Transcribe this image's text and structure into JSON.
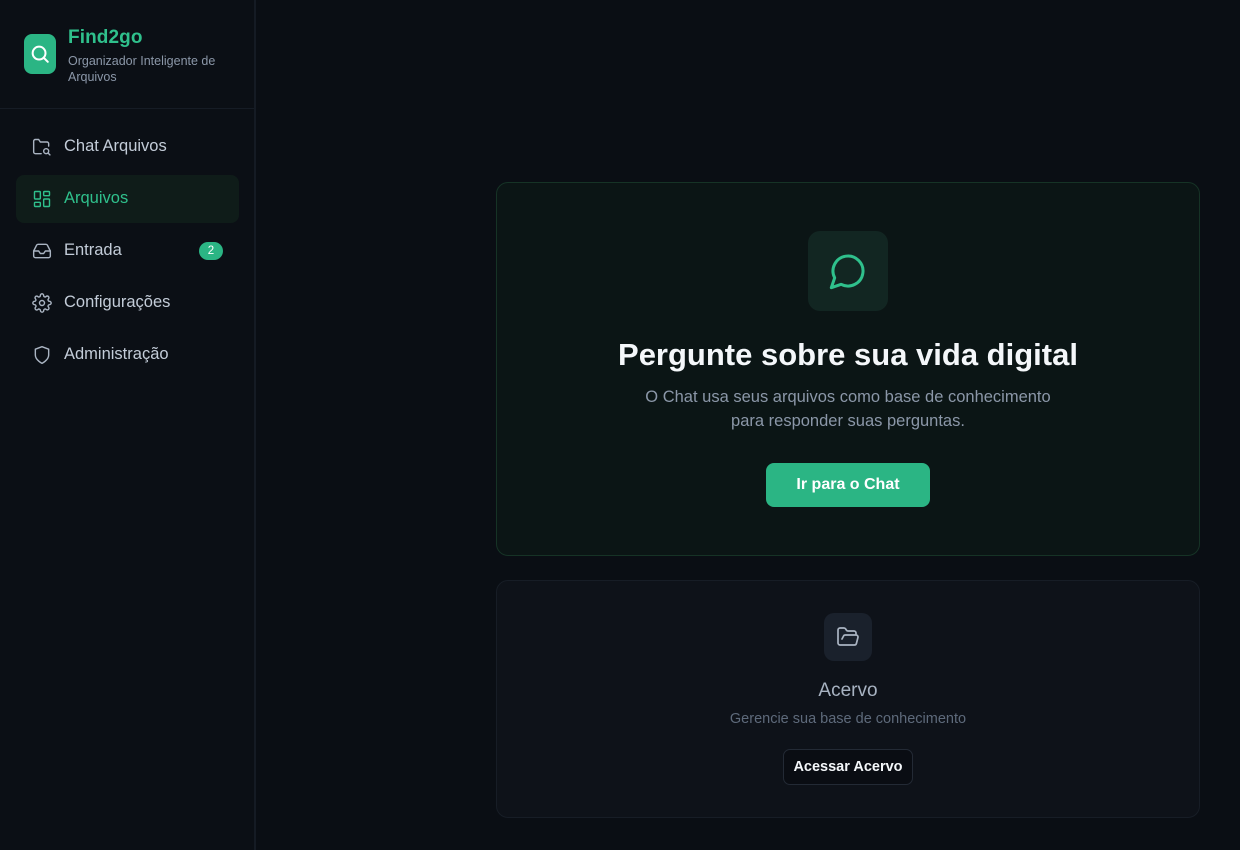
{
  "brand": {
    "name": "Find2go",
    "subtitle": "Organizador Inteligente de Arquivos",
    "logo_icon": "search-icon",
    "accent_color": "#2bb584"
  },
  "sidebar": {
    "items": [
      {
        "label": "Chat Arquivos",
        "icon": "folder-search-icon",
        "active": false
      },
      {
        "label": "Arquivos",
        "icon": "dashboard-icon",
        "active": true
      },
      {
        "label": "Entrada",
        "icon": "inbox-icon",
        "active": false,
        "badge": "2"
      },
      {
        "label": "Configurações",
        "icon": "gear-icon",
        "active": false
      },
      {
        "label": "Administração",
        "icon": "shield-icon",
        "active": false
      }
    ]
  },
  "main": {
    "chat_card": {
      "icon": "chat-bubble-icon",
      "title": "Pergunte sobre sua vida digital",
      "description": "O Chat usa seus arquivos como base de conhecimento para responder suas perguntas.",
      "button_label": "Ir para o Chat"
    },
    "acervo_card": {
      "icon": "folder-open-icon",
      "title": "Acervo",
      "description": "Gerencie sua base de conhecimento",
      "button_label": "Acessar Acervo"
    }
  }
}
